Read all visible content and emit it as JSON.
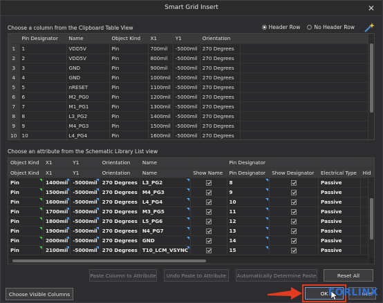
{
  "window": {
    "title": "Smart Grid Insert",
    "close_symbol": "✕"
  },
  "clipboard": {
    "label": "Choose a column from the Clipboard Table View",
    "radio": {
      "header_row": "Header Row",
      "no_header_row": "No Header Row",
      "selected": "header_row"
    },
    "columns": [
      "Pin Designator",
      "Name",
      "Object Kind",
      "X1",
      "Y1",
      "Orientation"
    ],
    "rows": [
      {
        "n": "1",
        "cells": [
          "1",
          "VDD5V",
          "Pin",
          "700mil",
          "-5000mil",
          "270 Degrees"
        ]
      },
      {
        "n": "2",
        "cells": [
          "2",
          "VDD5V",
          "Pin",
          "800mil",
          "-5000mil",
          "270 Degrees"
        ]
      },
      {
        "n": "3",
        "cells": [
          "3",
          "GND",
          "Pin",
          "900mil",
          "-5000mil",
          "270 Degrees"
        ]
      },
      {
        "n": "4",
        "cells": [
          "4",
          "GND",
          "Pin",
          "1000mil",
          "-5000mil",
          "270 Degrees"
        ]
      },
      {
        "n": "5",
        "cells": [
          "5",
          "nRESET",
          "Pin",
          "1100mil",
          "-5000mil",
          "270 Degrees"
        ]
      },
      {
        "n": "6",
        "cells": [
          "6",
          "M2_PG0",
          "Pin",
          "1200mil",
          "-5000mil",
          "270 Degrees"
        ]
      },
      {
        "n": "7",
        "cells": [
          "7",
          "M1_PG1",
          "Pin",
          "1300mil",
          "-5000mil",
          "270 Degrees"
        ]
      },
      {
        "n": "8",
        "cells": [
          "8",
          "L3_PG2",
          "Pin",
          "1400mil",
          "-5000mil",
          "270 Degrees"
        ]
      },
      {
        "n": "9",
        "cells": [
          "9",
          "M4_PG3",
          "Pin",
          "1500mil",
          "-5000mil",
          "270 Degrees"
        ]
      },
      {
        "n": "10",
        "cells": [
          "10",
          "L4_PG4",
          "Pin",
          "1600mil",
          "-5000mil",
          "270 Degrees"
        ]
      }
    ]
  },
  "schematic": {
    "label": "Choose an attribute from the Schematic Library List view",
    "group_headers": [
      "Object Kind",
      "X1",
      "Y1",
      "Orientation",
      "Name",
      "",
      "Pin Designator",
      "",
      "",
      ""
    ],
    "columns": [
      "Object Kind",
      "X1",
      "Y1",
      "Orientation",
      "Name",
      "Show Name",
      "Pin Designator",
      "Show Designator",
      "Electrical Type",
      "Hid"
    ],
    "rows": [
      {
        "kind": "Pin",
        "x1": "1400mil",
        "y1": "-5000mil",
        "orient": "270 Degrees",
        "name": "L3_PG2",
        "designator": "8",
        "etype": "Passive"
      },
      {
        "kind": "Pin",
        "x1": "1500mil",
        "y1": "-5000mil",
        "orient": "270 Degrees",
        "name": "M4_PG3",
        "designator": "9",
        "etype": "Passive"
      },
      {
        "kind": "Pin",
        "x1": "1600mil",
        "y1": "-5000mil",
        "orient": "270 Degrees",
        "name": "L4_PG4",
        "designator": "10",
        "etype": "Passive"
      },
      {
        "kind": "Pin",
        "x1": "1700mil",
        "y1": "-5000mil",
        "orient": "270 Degrees",
        "name": "M3_PG5",
        "designator": "11",
        "etype": "Passive"
      },
      {
        "kind": "Pin",
        "x1": "1800mil",
        "y1": "-5000mil",
        "orient": "270 Degrees",
        "name": "L5_PG6",
        "designator": "12",
        "etype": "Passive"
      },
      {
        "kind": "Pin",
        "x1": "1900mil",
        "y1": "-5000mil",
        "orient": "270 Degrees",
        "name": "N4_PG7",
        "designator": "13",
        "etype": "Passive"
      },
      {
        "kind": "Pin",
        "x1": "2000mil",
        "y1": "-5000mil",
        "orient": "270 Degrees",
        "name": "GND",
        "designator": "14",
        "etype": "Passive"
      },
      {
        "kind": "Pin",
        "x1": "2100mil",
        "y1": "-5000mil",
        "orient": "270 Degrees",
        "name": "T10_LCM_VSYNC",
        "designator": "15",
        "etype": "Passive"
      }
    ]
  },
  "buttons": {
    "paste_column": "Paste Column to Attribute",
    "undo_paste": "Undo Paste to Attribute",
    "auto_determine": "Automatically Determine Paste",
    "reset_all": "Reset All",
    "choose_visible": "Choose Visible Columns",
    "ok": "OK",
    "cancel": "ncel"
  },
  "watermark": "FORLINX",
  "colors": {
    "highlight": "#e23b1f",
    "marker_blue": "#4ea3ff",
    "marker_green": "#4ec94e",
    "watermark": "#2f6fd1"
  }
}
